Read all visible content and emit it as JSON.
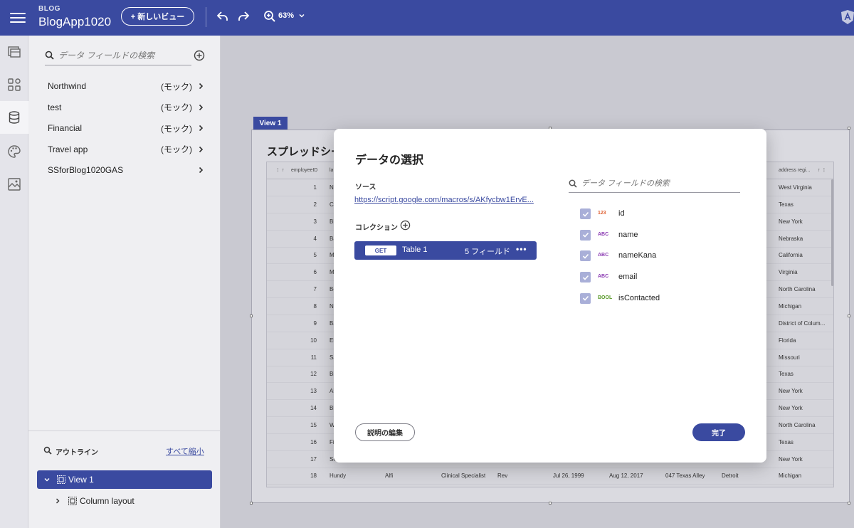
{
  "app": {
    "subtitle": "BLOG",
    "title": "BlogApp1020"
  },
  "toolbar": {
    "new_view_label": "+ 新しいビュー",
    "zoom": "63%"
  },
  "colors": {
    "primary": "#3a4aa0",
    "number_type": "#e0663a",
    "text_type": "#8b3bb3",
    "bool_type": "#5a9a2a"
  },
  "rail": {
    "items": [
      "views-icon",
      "components-icon",
      "data-icon",
      "theme-icon",
      "assets-icon"
    ]
  },
  "panel": {
    "search_placeholder": "データ フィールドの検索",
    "sources": [
      {
        "name": "Northwind",
        "tag": "(モック)"
      },
      {
        "name": "test",
        "tag": "(モック)"
      },
      {
        "name": "Financial",
        "tag": "(モック)"
      },
      {
        "name": "Travel app",
        "tag": "(モック)"
      },
      {
        "name": "SSforBlog1020GAS",
        "tag": ""
      }
    ]
  },
  "outline": {
    "title": "アウトライン",
    "collapse_all": "すべて縮小",
    "items": [
      "View 1",
      "Column layout"
    ]
  },
  "canvas": {
    "view_tag": "View 1",
    "sheet_title": "スプレッドシー",
    "header_left": "employeeID",
    "header_left2": "la",
    "header_right": "address regi...",
    "last_row": [
      "Hundy",
      "Alfi",
      "Clinical Specialist",
      "Rev",
      "Jul 26, 1999",
      "Aug 12, 2017",
      "047 Texas Alley",
      "Detroit"
    ],
    "rows": [
      {
        "id": "1",
        "ln": "N",
        "region": "West Virginia"
      },
      {
        "id": "2",
        "ln": "Ca",
        "region": "Texas"
      },
      {
        "id": "3",
        "ln": "Bi",
        "region": "New York"
      },
      {
        "id": "4",
        "ln": "Ba",
        "region": "Nebraska"
      },
      {
        "id": "5",
        "ln": "M",
        "region": "California"
      },
      {
        "id": "6",
        "ln": "M",
        "region": "Virginia"
      },
      {
        "id": "7",
        "ln": "Be",
        "region": "North Carolina"
      },
      {
        "id": "8",
        "ln": "N",
        "region": "Michigan"
      },
      {
        "id": "9",
        "ln": "Ba",
        "region": "District of Colum..."
      },
      {
        "id": "10",
        "ln": "El",
        "region": "Florida"
      },
      {
        "id": "11",
        "ln": "Sa",
        "region": "Missouri"
      },
      {
        "id": "12",
        "ln": "Bi",
        "region": "Texas"
      },
      {
        "id": "13",
        "ln": "Ai",
        "region": "New York"
      },
      {
        "id": "14",
        "ln": "Bl",
        "region": "New York"
      },
      {
        "id": "15",
        "ln": "W",
        "region": "North Carolina"
      },
      {
        "id": "16",
        "ln": "Fi",
        "region": "Texas"
      },
      {
        "id": "17",
        "ln": "Se",
        "region": "New York"
      },
      {
        "id": "18",
        "ln": "Hundy",
        "region": "Michigan"
      }
    ]
  },
  "dialog": {
    "title": "データの選択",
    "source_label": "ソース",
    "source_url": "https://script.google.com/macros/s/AKfycbw1ErvE...",
    "collection_label": "コレクション",
    "collection": {
      "method": "GET",
      "name": "Table 1",
      "fields": "5 フィールド",
      "more": "•••"
    },
    "search_placeholder": "データ フィールドの検索",
    "fields": [
      {
        "type": "123",
        "name": "id",
        "kind": "number"
      },
      {
        "type": "ABC",
        "name": "name",
        "kind": "text"
      },
      {
        "type": "ABC",
        "name": "nameKana",
        "kind": "text"
      },
      {
        "type": "ABC",
        "name": "email",
        "kind": "text"
      },
      {
        "type": "BOOL",
        "name": "isContacted",
        "kind": "bool"
      }
    ],
    "edit_description": "説明の編集",
    "done": "完了"
  }
}
